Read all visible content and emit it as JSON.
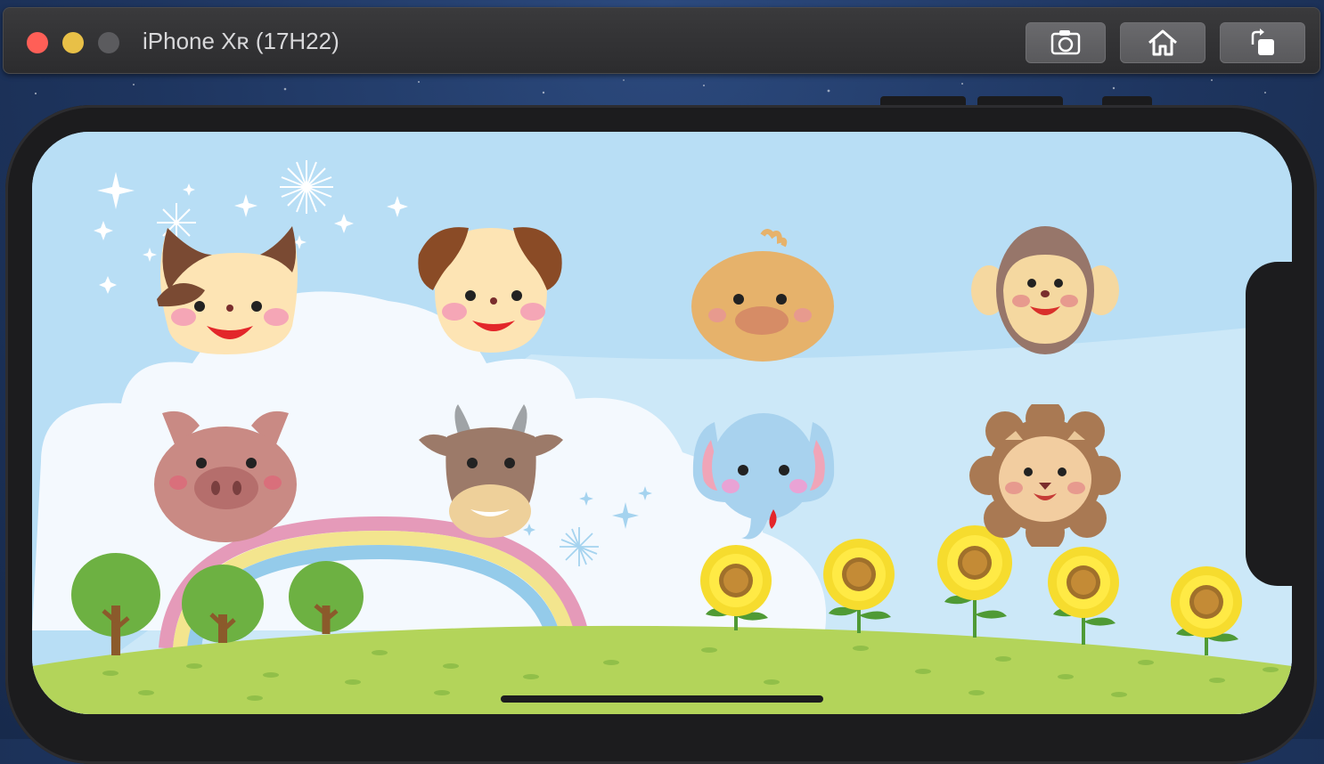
{
  "window": {
    "title": "iPhone Xʀ (17H22)",
    "buttons": [
      {
        "name": "screenshot",
        "icon": "camera-icon"
      },
      {
        "name": "home",
        "icon": "home-icon"
      },
      {
        "name": "rotate",
        "icon": "rotate-icon"
      }
    ]
  },
  "app": {
    "animals": [
      {
        "id": "cat"
      },
      {
        "id": "dog"
      },
      {
        "id": "chick"
      },
      {
        "id": "monkey"
      },
      {
        "id": "pig"
      },
      {
        "id": "cow"
      },
      {
        "id": "elephant"
      },
      {
        "id": "lion"
      }
    ]
  },
  "colors": {
    "sky": "#b8def5",
    "grass": "#b3d45a",
    "close": "#ff5f57",
    "minimize": "#e8c047",
    "zoom": "#5b5b5e"
  }
}
